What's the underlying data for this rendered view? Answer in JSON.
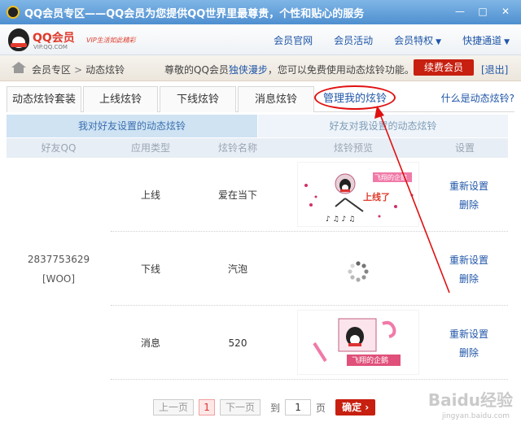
{
  "window": {
    "title": "QQ会员专区——QQ会员为您提供QQ世界里最尊贵，个性和贴心的服务",
    "minimize": "—",
    "maximize": "□",
    "close": "✕"
  },
  "logo": {
    "brand": "QQ会员",
    "domain": "VIP.QQ.COM",
    "slogan": "VIP生活如此精彩"
  },
  "nav": {
    "items": [
      "会员官网",
      "会员活动",
      "会员特权",
      "快捷通道"
    ],
    "dropdown_caret": "▼"
  },
  "breadcrumb": {
    "home": "会员专区",
    "separator": ">",
    "current": "动态炫铃"
  },
  "notice": {
    "prefix": "尊敬的QQ会员",
    "name": "独侠漫步",
    "suffix": "，您可以免费使用动态炫铃功能。"
  },
  "renew_button": "续费会员",
  "logout": "[退出]",
  "tabs": [
    "动态炫铃套装",
    "上线炫铃",
    "下线炫铃",
    "消息炫铃",
    "管理我的炫铃"
  ],
  "tab_help": "什么是动态炫铃?",
  "subtabs": [
    "我对好友设置的动态炫铃",
    "好友对我设置的动态炫铃"
  ],
  "table": {
    "headers": [
      "好友QQ",
      "应用类型",
      "炫铃名称",
      "炫铃预览",
      "设置"
    ],
    "friend_qq": "2837753629",
    "friend_name": "[WOO]",
    "rows": [
      {
        "type": "上线",
        "name": "爱在当下",
        "preview_text": "上线了",
        "preview_tag": "飞翔的企鹅",
        "op1": "重新设置",
        "op2": "删除"
      },
      {
        "type": "下线",
        "name": "汽泡",
        "op1": "重新设置",
        "op2": "删除"
      },
      {
        "type": "消息",
        "name": "520",
        "preview_tag": "飞翔的企鹅",
        "op1": "重新设置",
        "op2": "删除"
      }
    ]
  },
  "pager": {
    "prev": "上一页",
    "current": "1",
    "next": "下一页",
    "goto_label": "到",
    "goto_value": "1",
    "page_unit": "页",
    "confirm": "确定",
    "confirm_arrow": "›"
  },
  "watermark": "Baidu经验",
  "watermark_sub": "jingyan.baidu.com",
  "colors": {
    "accent_red": "#c71f10",
    "link_blue": "#1f56a8",
    "annotation_red": "#e01010"
  }
}
